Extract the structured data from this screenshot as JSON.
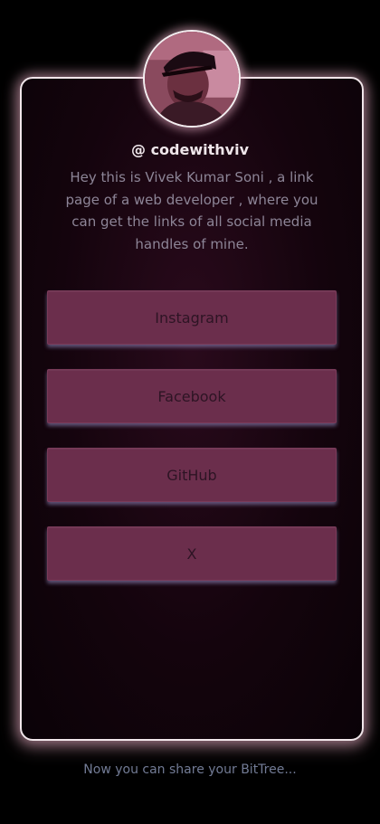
{
  "profile": {
    "username": "@ codewithviv",
    "bio": "Hey this is Vivek Kumar Soni , a link page of a web developer , where you can get the links of all social media handles of mine."
  },
  "links": [
    {
      "label": "Instagram"
    },
    {
      "label": "Facebook"
    },
    {
      "label": "GitHub"
    },
    {
      "label": "X"
    }
  ],
  "footer": {
    "text": "Now you can share your BitTree..."
  },
  "colors": {
    "background": "#000000",
    "card_border": "#f1e6ea",
    "button": "#6b2e4c",
    "username": "#efe6ea",
    "bio_text": "#8d8597",
    "footer_text": "#727b95"
  }
}
